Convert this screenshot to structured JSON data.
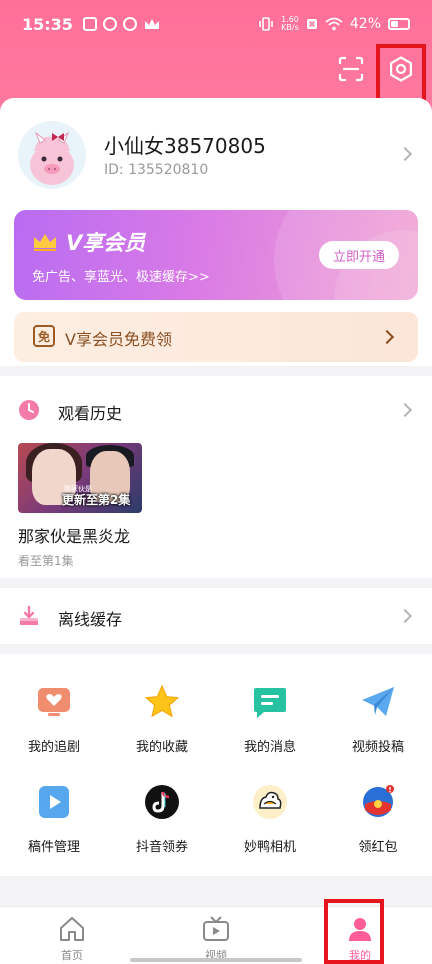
{
  "status_bar": {
    "time": "15:35",
    "net_speed_value": "1.60",
    "net_speed_unit": "KB/s",
    "battery_percent": "42%"
  },
  "header": {
    "scan_icon": "scan-icon",
    "settings_icon": "gear-icon"
  },
  "profile": {
    "username": "小仙女38570805",
    "user_id": "ID: 135520810"
  },
  "vip_banner": {
    "title": "V享会员",
    "subtitle": "免广告、享蓝光、极速缓存>>",
    "button_label": "立即开通"
  },
  "free_vip": {
    "badge": "免",
    "label": "V享会员免费领"
  },
  "history": {
    "title": "观看历史",
    "items": [
      {
        "thumbnail_small_text": "那家伙是",
        "thumbnail_caption": "更新至第2集",
        "title": "那家伙是黑炎龙",
        "progress": "看至第1集"
      }
    ]
  },
  "offline": {
    "title": "离线缓存"
  },
  "features": [
    {
      "label": "我的追剧",
      "icon": "tv-heart-icon"
    },
    {
      "label": "我的收藏",
      "icon": "star-icon"
    },
    {
      "label": "我的消息",
      "icon": "message-icon"
    },
    {
      "label": "视频投稿",
      "icon": "paper-plane-icon"
    },
    {
      "label": "稿件管理",
      "icon": "video-file-icon"
    },
    {
      "label": "抖音领券",
      "icon": "douyin-icon"
    },
    {
      "label": "妙鸭相机",
      "icon": "duck-camera-icon"
    },
    {
      "label": "领红包",
      "icon": "red-packet-icon"
    }
  ],
  "tabbar": {
    "tabs": [
      {
        "label": "首页",
        "icon": "home-icon",
        "active": false
      },
      {
        "label": "视频",
        "icon": "tv-icon",
        "active": false
      },
      {
        "label": "我的",
        "icon": "person-icon",
        "active": true
      }
    ]
  },
  "colors": {
    "brand_pink": "#ff6f98",
    "vip_gradient_start": "#b86cf2",
    "vip_gradient_end": "#f1a4d2",
    "highlight_red": "#e5141d",
    "active_tab": "#ff5c9a"
  }
}
